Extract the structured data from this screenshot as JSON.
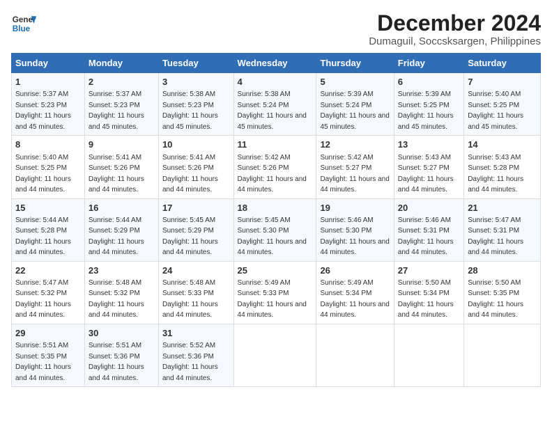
{
  "logo": {
    "line1": "General",
    "line2": "Blue"
  },
  "title": "December 2024",
  "subtitle": "Dumaguil, Soccsksargen, Philippines",
  "days_of_week": [
    "Sunday",
    "Monday",
    "Tuesday",
    "Wednesday",
    "Thursday",
    "Friday",
    "Saturday"
  ],
  "weeks": [
    [
      {
        "day": "1",
        "sunrise": "Sunrise: 5:37 AM",
        "sunset": "Sunset: 5:23 PM",
        "daylight": "Daylight: 11 hours and 45 minutes."
      },
      {
        "day": "2",
        "sunrise": "Sunrise: 5:37 AM",
        "sunset": "Sunset: 5:23 PM",
        "daylight": "Daylight: 11 hours and 45 minutes."
      },
      {
        "day": "3",
        "sunrise": "Sunrise: 5:38 AM",
        "sunset": "Sunset: 5:23 PM",
        "daylight": "Daylight: 11 hours and 45 minutes."
      },
      {
        "day": "4",
        "sunrise": "Sunrise: 5:38 AM",
        "sunset": "Sunset: 5:24 PM",
        "daylight": "Daylight: 11 hours and 45 minutes."
      },
      {
        "day": "5",
        "sunrise": "Sunrise: 5:39 AM",
        "sunset": "Sunset: 5:24 PM",
        "daylight": "Daylight: 11 hours and 45 minutes."
      },
      {
        "day": "6",
        "sunrise": "Sunrise: 5:39 AM",
        "sunset": "Sunset: 5:25 PM",
        "daylight": "Daylight: 11 hours and 45 minutes."
      },
      {
        "day": "7",
        "sunrise": "Sunrise: 5:40 AM",
        "sunset": "Sunset: 5:25 PM",
        "daylight": "Daylight: 11 hours and 45 minutes."
      }
    ],
    [
      {
        "day": "8",
        "sunrise": "Sunrise: 5:40 AM",
        "sunset": "Sunset: 5:25 PM",
        "daylight": "Daylight: 11 hours and 44 minutes."
      },
      {
        "day": "9",
        "sunrise": "Sunrise: 5:41 AM",
        "sunset": "Sunset: 5:26 PM",
        "daylight": "Daylight: 11 hours and 44 minutes."
      },
      {
        "day": "10",
        "sunrise": "Sunrise: 5:41 AM",
        "sunset": "Sunset: 5:26 PM",
        "daylight": "Daylight: 11 hours and 44 minutes."
      },
      {
        "day": "11",
        "sunrise": "Sunrise: 5:42 AM",
        "sunset": "Sunset: 5:26 PM",
        "daylight": "Daylight: 11 hours and 44 minutes."
      },
      {
        "day": "12",
        "sunrise": "Sunrise: 5:42 AM",
        "sunset": "Sunset: 5:27 PM",
        "daylight": "Daylight: 11 hours and 44 minutes."
      },
      {
        "day": "13",
        "sunrise": "Sunrise: 5:43 AM",
        "sunset": "Sunset: 5:27 PM",
        "daylight": "Daylight: 11 hours and 44 minutes."
      },
      {
        "day": "14",
        "sunrise": "Sunrise: 5:43 AM",
        "sunset": "Sunset: 5:28 PM",
        "daylight": "Daylight: 11 hours and 44 minutes."
      }
    ],
    [
      {
        "day": "15",
        "sunrise": "Sunrise: 5:44 AM",
        "sunset": "Sunset: 5:28 PM",
        "daylight": "Daylight: 11 hours and 44 minutes."
      },
      {
        "day": "16",
        "sunrise": "Sunrise: 5:44 AM",
        "sunset": "Sunset: 5:29 PM",
        "daylight": "Daylight: 11 hours and 44 minutes."
      },
      {
        "day": "17",
        "sunrise": "Sunrise: 5:45 AM",
        "sunset": "Sunset: 5:29 PM",
        "daylight": "Daylight: 11 hours and 44 minutes."
      },
      {
        "day": "18",
        "sunrise": "Sunrise: 5:45 AM",
        "sunset": "Sunset: 5:30 PM",
        "daylight": "Daylight: 11 hours and 44 minutes."
      },
      {
        "day": "19",
        "sunrise": "Sunrise: 5:46 AM",
        "sunset": "Sunset: 5:30 PM",
        "daylight": "Daylight: 11 hours and 44 minutes."
      },
      {
        "day": "20",
        "sunrise": "Sunrise: 5:46 AM",
        "sunset": "Sunset: 5:31 PM",
        "daylight": "Daylight: 11 hours and 44 minutes."
      },
      {
        "day": "21",
        "sunrise": "Sunrise: 5:47 AM",
        "sunset": "Sunset: 5:31 PM",
        "daylight": "Daylight: 11 hours and 44 minutes."
      }
    ],
    [
      {
        "day": "22",
        "sunrise": "Sunrise: 5:47 AM",
        "sunset": "Sunset: 5:32 PM",
        "daylight": "Daylight: 11 hours and 44 minutes."
      },
      {
        "day": "23",
        "sunrise": "Sunrise: 5:48 AM",
        "sunset": "Sunset: 5:32 PM",
        "daylight": "Daylight: 11 hours and 44 minutes."
      },
      {
        "day": "24",
        "sunrise": "Sunrise: 5:48 AM",
        "sunset": "Sunset: 5:33 PM",
        "daylight": "Daylight: 11 hours and 44 minutes."
      },
      {
        "day": "25",
        "sunrise": "Sunrise: 5:49 AM",
        "sunset": "Sunset: 5:33 PM",
        "daylight": "Daylight: 11 hours and 44 minutes."
      },
      {
        "day": "26",
        "sunrise": "Sunrise: 5:49 AM",
        "sunset": "Sunset: 5:34 PM",
        "daylight": "Daylight: 11 hours and 44 minutes."
      },
      {
        "day": "27",
        "sunrise": "Sunrise: 5:50 AM",
        "sunset": "Sunset: 5:34 PM",
        "daylight": "Daylight: 11 hours and 44 minutes."
      },
      {
        "day": "28",
        "sunrise": "Sunrise: 5:50 AM",
        "sunset": "Sunset: 5:35 PM",
        "daylight": "Daylight: 11 hours and 44 minutes."
      }
    ],
    [
      {
        "day": "29",
        "sunrise": "Sunrise: 5:51 AM",
        "sunset": "Sunset: 5:35 PM",
        "daylight": "Daylight: 11 hours and 44 minutes."
      },
      {
        "day": "30",
        "sunrise": "Sunrise: 5:51 AM",
        "sunset": "Sunset: 5:36 PM",
        "daylight": "Daylight: 11 hours and 44 minutes."
      },
      {
        "day": "31",
        "sunrise": "Sunrise: 5:52 AM",
        "sunset": "Sunset: 5:36 PM",
        "daylight": "Daylight: 11 hours and 44 minutes."
      },
      null,
      null,
      null,
      null
    ]
  ]
}
